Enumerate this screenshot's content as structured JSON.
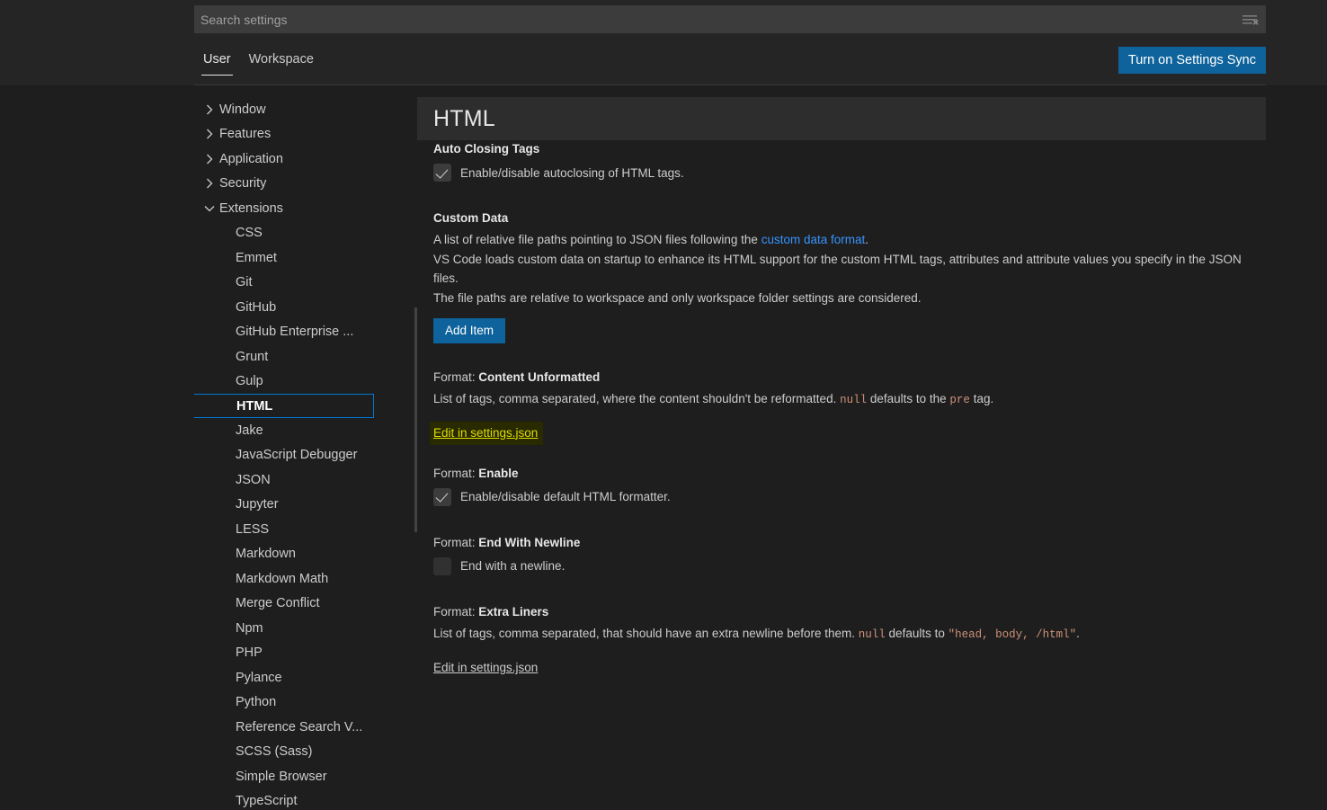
{
  "header": {
    "search": {
      "placeholder": "Search settings",
      "value": "",
      "clear_icon": "clear-filter-icon"
    },
    "tabs": [
      {
        "label": "User",
        "active": true
      },
      {
        "label": "Workspace",
        "active": false
      }
    ],
    "sync_button": "Turn on Settings Sync"
  },
  "toc": {
    "groups": [
      {
        "label": "Window",
        "expanded": false,
        "icon": "chevron-right-icon"
      },
      {
        "label": "Features",
        "expanded": false,
        "icon": "chevron-right-icon"
      },
      {
        "label": "Application",
        "expanded": false,
        "icon": "chevron-right-icon"
      },
      {
        "label": "Security",
        "expanded": false,
        "icon": "chevron-right-icon"
      },
      {
        "label": "Extensions",
        "expanded": true,
        "icon": "chevron-down-icon"
      }
    ],
    "extensions": [
      {
        "label": "CSS",
        "selected": false
      },
      {
        "label": "Emmet",
        "selected": false
      },
      {
        "label": "Git",
        "selected": false
      },
      {
        "label": "GitHub",
        "selected": false
      },
      {
        "label": "GitHub Enterprise ...",
        "selected": false
      },
      {
        "label": "Grunt",
        "selected": false
      },
      {
        "label": "Gulp",
        "selected": false
      },
      {
        "label": "HTML",
        "selected": true
      },
      {
        "label": "Jake",
        "selected": false
      },
      {
        "label": "JavaScript Debugger",
        "selected": false
      },
      {
        "label": "JSON",
        "selected": false
      },
      {
        "label": "Jupyter",
        "selected": false
      },
      {
        "label": "LESS",
        "selected": false
      },
      {
        "label": "Markdown",
        "selected": false
      },
      {
        "label": "Markdown Math",
        "selected": false
      },
      {
        "label": "Merge Conflict",
        "selected": false
      },
      {
        "label": "Npm",
        "selected": false
      },
      {
        "label": "PHP",
        "selected": false
      },
      {
        "label": "Pylance",
        "selected": false
      },
      {
        "label": "Python",
        "selected": false
      },
      {
        "label": "Reference Search V...",
        "selected": false
      },
      {
        "label": "SCSS (Sass)",
        "selected": false
      },
      {
        "label": "Simple Browser",
        "selected": false
      },
      {
        "label": "TypeScript",
        "selected": false
      }
    ]
  },
  "pane": {
    "title": "HTML",
    "settings": {
      "auto_closing_tags": {
        "label": "Auto Closing Tags",
        "checkbox_label": "Enable/disable autoclosing of HTML tags.",
        "checked": true
      },
      "custom_data": {
        "label": "Custom Data",
        "desc_line1_a": "A list of relative file paths pointing to JSON files following the ",
        "desc_link": "custom data format",
        "desc_line1_b": ".",
        "desc_line2": "VS Code loads custom data on startup to enhance its HTML support for the custom HTML tags, attributes and attribute values you specify in the JSON files.",
        "desc_line3": "The file paths are relative to workspace and only workspace folder settings are considered.",
        "add_button": "Add Item"
      },
      "content_unformatted": {
        "category": "Format: ",
        "name": "Content Unformatted",
        "desc_a": "List of tags, comma separated, where the content shouldn't be reformatted. ",
        "code_null": "null",
        "desc_b": " defaults to the ",
        "code_pre": "pre",
        "desc_c": " tag.",
        "edit_link": "Edit in settings.json",
        "highlighted": true
      },
      "format_enable": {
        "category": "Format: ",
        "name": "Enable",
        "checkbox_label": "Enable/disable default HTML formatter.",
        "checked": true
      },
      "end_with_newline": {
        "category": "Format: ",
        "name": "End With Newline",
        "checkbox_label": "End with a newline.",
        "checked": false
      },
      "extra_liners": {
        "category": "Format: ",
        "name": "Extra Liners",
        "desc_a": "List of tags, comma separated, that should have an extra newline before them. ",
        "code_null": "null",
        "desc_b": " defaults to ",
        "code_tags": "\"head, body, /html\"",
        "desc_c": ".",
        "edit_link": "Edit in settings.json",
        "highlighted": false
      }
    }
  },
  "colors": {
    "accent_blue": "#0e639c",
    "focus_blue": "#0078d4",
    "link_blue": "#3794ff",
    "editor_bg": "#1e1e1e",
    "header_bg": "#252526",
    "title_band_bg": "#2d2d2d",
    "code_orange": "#ce9178",
    "highlight_yellow": "#dddd00",
    "highlight_bg": "#2a2a00"
  }
}
